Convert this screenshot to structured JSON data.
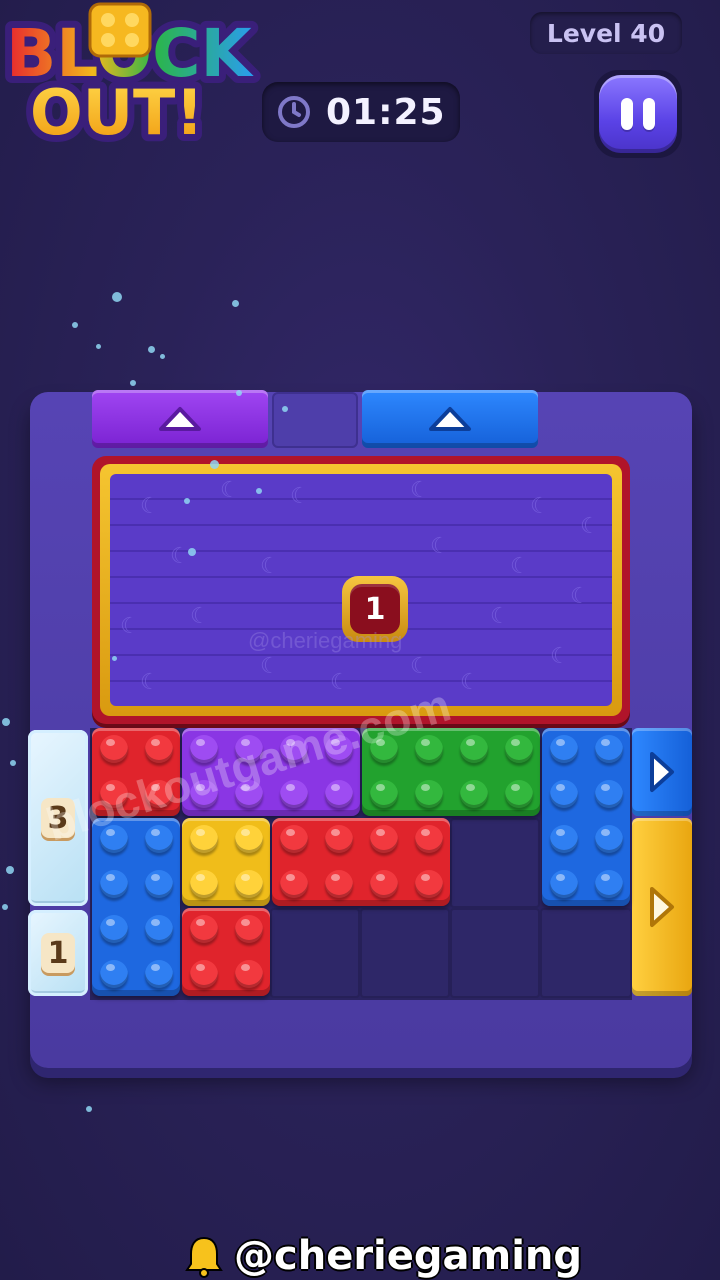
{
  "header": {
    "logo_line1": "BLOCK",
    "logo_line2": "OUT!",
    "level_label": "Level 40",
    "timer": "01:25",
    "pause_icon": "pause-icon",
    "clock_icon": "clock-icon"
  },
  "board": {
    "frozen_counter": "1",
    "ice_blocks": [
      {
        "name": "ice-block-3",
        "count": "3"
      },
      {
        "name": "ice-block-1",
        "count": "1"
      }
    ],
    "gates": [
      {
        "name": "gate-top-purple",
        "color": "#8a2ee0"
      },
      {
        "name": "gate-top-blue",
        "color": "#1c6ef0"
      },
      {
        "name": "gate-right-blue",
        "color": "#1c6ef0"
      },
      {
        "name": "gate-right-yellow",
        "color": "#f2b81c"
      }
    ],
    "bricks": [
      {
        "name": "brick-red-2x2-top-left",
        "color": "red"
      },
      {
        "name": "brick-purple-4x2",
        "color": "purple"
      },
      {
        "name": "brick-green-4x2",
        "color": "green"
      },
      {
        "name": "brick-blue-2x4-right",
        "color": "blue"
      },
      {
        "name": "brick-blue-2x4-left",
        "color": "blue"
      },
      {
        "name": "brick-yellow-2x2",
        "color": "yellow"
      },
      {
        "name": "brick-red-4x2",
        "color": "red"
      },
      {
        "name": "brick-red-2x2-bottom",
        "color": "red"
      }
    ]
  },
  "watermarks": {
    "site": "blockoutgame.com",
    "handle": "@cheriegaming"
  },
  "footer": {
    "handle": "@cheriegaming",
    "icon": "bell-icon"
  },
  "colors": {
    "background": "#2a2258",
    "board": "#4a3aa0",
    "red": "#e3242c",
    "blue": "#1f6ee8",
    "purple": "#8b38e6",
    "green": "#26a832",
    "yellow": "#f2c11e"
  }
}
